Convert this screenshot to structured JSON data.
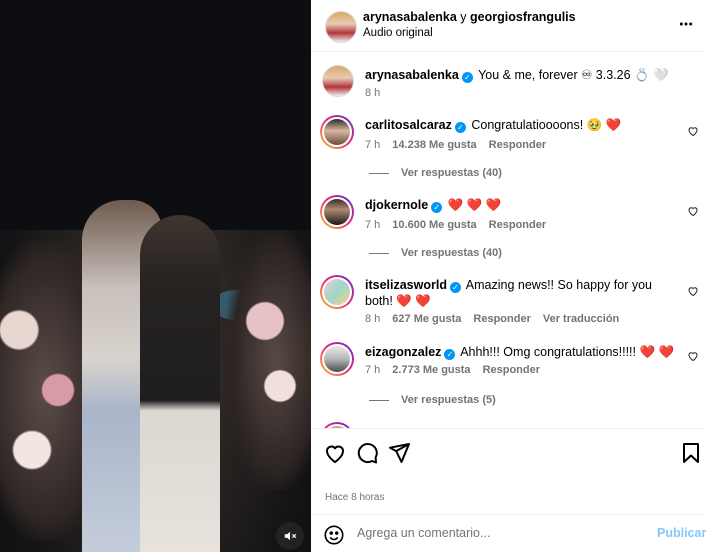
{
  "header": {
    "user1": "arynasabalenka",
    "joiner": "y",
    "user2": "georgiosfrangulis",
    "subtitle": "Audio original",
    "more_icon": "more-horizontal-icon"
  },
  "caption": {
    "username": "arynasabalenka",
    "text": "You & me, forever ♾ 3.3.26 💍 🤍",
    "time": "8 h"
  },
  "comments": [
    {
      "username": "carlitosalcaraz",
      "text": "Congratulatioooons! 🥹 ❤️",
      "time": "7 h",
      "likes": "14.238 Me gusta",
      "reply": "Responder",
      "view_replies": "Ver respuestas (40)"
    },
    {
      "username": "djokernole",
      "text": "❤️ ❤️ ❤️",
      "time": "7 h",
      "likes": "10.600 Me gusta",
      "reply": "Responder",
      "view_replies": "Ver respuestas (40)"
    },
    {
      "username": "itselizasworld",
      "text": "Amazing news!! So happy for you both! ❤️ ❤️",
      "time": "8 h",
      "likes": "627 Me gusta",
      "reply": "Responder",
      "translate": "Ver traducción"
    },
    {
      "username": "eizagonzalez",
      "text": "Ahhh!!! Omg congratulations!!!!! ❤️ ❤️",
      "time": "7 h",
      "likes": "2.773 Me gusta",
      "reply": "Responder",
      "view_replies": "Ver respuestas (5)"
    }
  ],
  "actions": {
    "like_icon": "heart-icon",
    "comment_icon": "comment-icon",
    "share_icon": "send-icon",
    "save_icon": "bookmark-icon"
  },
  "posted": "Hace 8 horas",
  "add_comment": {
    "placeholder": "Agrega un comentario...",
    "publish": "Publicar"
  },
  "colors": {
    "verified": "#0095f6",
    "publish": "#85c8fa",
    "muted": "#737373"
  }
}
